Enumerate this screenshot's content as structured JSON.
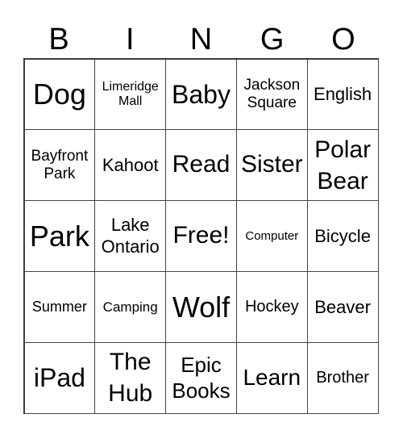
{
  "header": [
    "B",
    "I",
    "N",
    "G",
    "O"
  ],
  "cells": [
    "Dog",
    "Limeridge Mall",
    "Baby",
    "Jackson Square",
    "English",
    "Bayfront Park",
    "Kahoot",
    "Read",
    "Sister",
    "Polar Bear",
    "Park",
    "Lake Ontario",
    "Free!",
    "Computer",
    "Bicycle",
    "Summer",
    "Camping",
    "Wolf",
    "Hockey",
    "Beaver",
    "iPad",
    "The Hub",
    "Epic Books",
    "Learn",
    "Brother"
  ]
}
